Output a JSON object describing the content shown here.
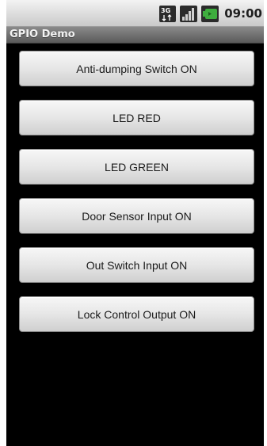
{
  "status_bar": {
    "network_icon": "3g-icon",
    "signal_icon": "signal-strength-icon",
    "battery_icon": "battery-icon",
    "time": "09:00"
  },
  "app": {
    "title": "GPIO Demo"
  },
  "buttons": [
    {
      "label": "Anti-dumping Switch ON"
    },
    {
      "label": "LED RED"
    },
    {
      "label": "LED GREEN"
    },
    {
      "label": "Door Sensor Input ON"
    },
    {
      "label": "Out Switch Input ON"
    },
    {
      "label": "Lock Control Output ON"
    }
  ],
  "colors": {
    "background": "#000000",
    "status_bar": "#dcdcdc",
    "title_bar": "#707070",
    "button_face": "#e6e6e6",
    "battery_accent": "#3fae3f"
  }
}
